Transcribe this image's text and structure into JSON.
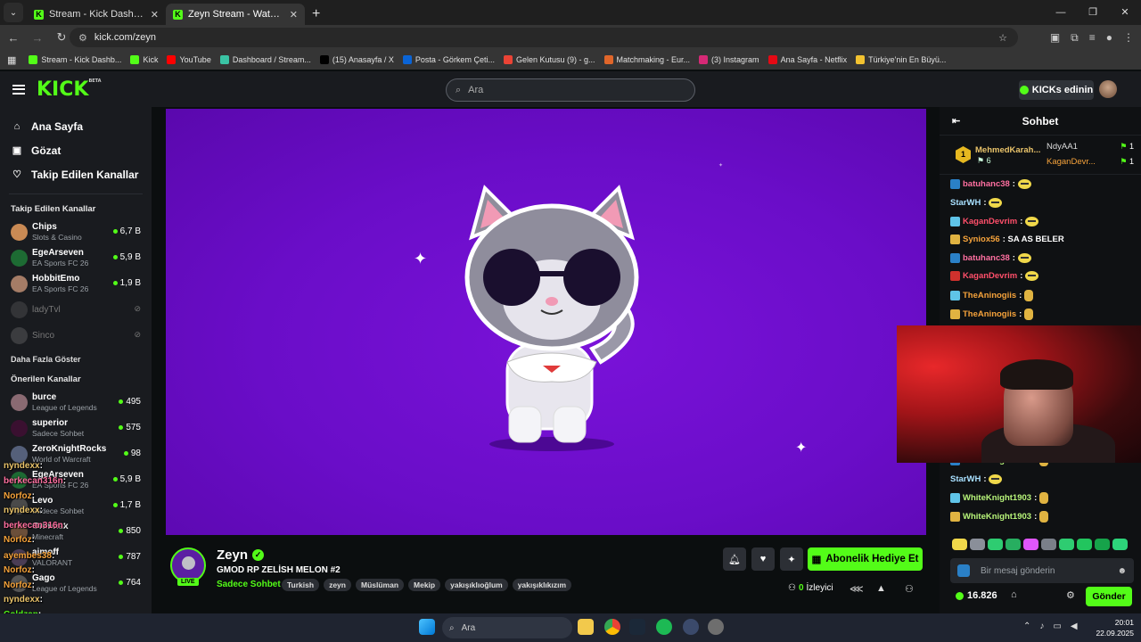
{
  "browser": {
    "tabs": [
      {
        "title": "Stream - Kick Dashboard",
        "active": false
      },
      {
        "title": "Zeyn Stream - Watch Live on Kick",
        "active": true
      }
    ],
    "url": "kick.com/zeyn",
    "bookmarks": [
      {
        "label": "Stream - Kick Dashb...",
        "color": "#53fc18"
      },
      {
        "label": "Kick",
        "color": "#53fc18"
      },
      {
        "label": "YouTube",
        "color": "#ff0000"
      },
      {
        "label": "Dashboard / Stream...",
        "color": "#3ac3a4"
      },
      {
        "label": "(15) Anasayfa / X",
        "color": "#000000"
      },
      {
        "label": "Posta - Görkem Çeti...",
        "color": "#0a64d6"
      },
      {
        "label": "Gelen Kutusu (9) - g...",
        "color": "#ea4335"
      },
      {
        "label": "Matchmaking - Eur...",
        "color": "#e0662a"
      },
      {
        "label": "(3) Instagram",
        "color": "#d62976"
      },
      {
        "label": "Ana Sayfa - Netflix",
        "color": "#e50914"
      },
      {
        "label": "Türkiye'nin En Büyü...",
        "color": "#f2c230"
      }
    ]
  },
  "header": {
    "logo": "KICK",
    "logo_beta": "BETA",
    "search_placeholder": "Ara",
    "kicks_button": "KICKs edinin"
  },
  "sidebar": {
    "nav": [
      {
        "label": "Ana Sayfa",
        "icon": "home-icon"
      },
      {
        "label": "Gözat",
        "icon": "browse-icon"
      },
      {
        "label": "Takip Edilen Kanallar",
        "icon": "heart-icon"
      }
    ],
    "followed_title": "Takip Edilen Kanallar",
    "followed": [
      {
        "name": "Chips",
        "game": "Slots & Casino",
        "viewers": "6,7 B",
        "avatar": "#c98a54"
      },
      {
        "name": "EgeArseven",
        "game": "EA Sports FC 26",
        "viewers": "5,9 B",
        "avatar": "#1d6b33"
      },
      {
        "name": "HobbitEmo",
        "game": "EA Sports FC 26",
        "viewers": "1,9 B",
        "avatar": "#a57c66"
      },
      {
        "name": "ladyTvl",
        "offline": true,
        "avatar": "#555555"
      },
      {
        "name": "Sinco",
        "offline": true,
        "avatar": "#666666"
      }
    ],
    "show_more": "Daha Fazla Göster",
    "recommended_title": "Önerilen Kanallar",
    "recommended": [
      {
        "name": "burce",
        "game": "League of Legends",
        "viewers": "495",
        "avatar": "#8a6a72"
      },
      {
        "name": "superior",
        "game": "Sadece Sohbet",
        "viewers": "575",
        "avatar": "#3a1030"
      },
      {
        "name": "ZeroKnightRocks",
        "game": "World of Warcraft",
        "viewers": "98",
        "avatar": "#55607a"
      },
      {
        "name": "EgeArseven",
        "game": "EA Sports FC 26",
        "viewers": "5,9 B",
        "avatar": "#1d6b33"
      },
      {
        "name": "Levo",
        "game": "Sadece Sohbet",
        "viewers": "1,7 B",
        "avatar": "#4a4a4a"
      },
      {
        "name": "Grimnax",
        "game": "Minecraft",
        "viewers": "850",
        "avatar": "#6b4f3a"
      },
      {
        "name": "aimoff",
        "game": "VALORANT",
        "viewers": "787",
        "avatar": "#4a3d55"
      },
      {
        "name": "Gago",
        "game": "League of Legends",
        "viewers": "764",
        "avatar": "#555555"
      }
    ],
    "overlay_chat": [
      {
        "user": "nyndexx",
        "text": ":",
        "color": "#e9c36a"
      },
      {
        "user": "berkecan316n",
        "text": ":",
        "color": "#ff6fa0"
      },
      {
        "user": "Norfoz",
        "text": ":",
        "color": "#f6a33b"
      },
      {
        "user": "nyndexx",
        "text": ":",
        "color": "#e9c36a"
      },
      {
        "user": "berkecan316n",
        "text": ":",
        "color": "#ff6fa0"
      },
      {
        "user": "Norfoz",
        "text": ":",
        "color": "#f6a33b"
      },
      {
        "user": "ayembes38",
        "text": ":",
        "color": "#f6a33b"
      },
      {
        "user": "Norfoz",
        "text": ":",
        "color": "#f6a33b"
      },
      {
        "user": "Norfoz",
        "text": ":",
        "color": "#f6a33b"
      },
      {
        "user": "nyndexx",
        "text": ":",
        "color": "#e9c36a"
      },
      {
        "user": "Coldzap",
        "text": ":",
        "color": "#53fc18"
      }
    ]
  },
  "stream": {
    "channel": "Zeyn",
    "live": "LIVE",
    "title": "GMOD RP ZELİSH MELON #2",
    "category": "Sadece Sohbet",
    "tags": [
      "Turkish",
      "zeyn",
      "Müslüman",
      "Mekip",
      "yakışıklıoğlum",
      "yakışıklıkızım"
    ],
    "subscribe_gift": "Abonelik Hediye Et",
    "viewers_count": "0",
    "viewers_label": "İzleyici"
  },
  "chat": {
    "title": "Sohbet",
    "pinned": {
      "top_user": "MehmedKarah...",
      "top_count": "6",
      "rank": "1",
      "others": [
        {
          "user": "NdyAA1",
          "count": "1"
        },
        {
          "user": "KaganDevr...",
          "count": "1"
        }
      ]
    },
    "messages": [
      {
        "user": "batuhanc38",
        "text": ":",
        "color": "#ff6fa0",
        "emote": "yellow"
      },
      {
        "user": "StarWH",
        "text": ":",
        "color": "#a8e0ff",
        "emote": "yellow"
      },
      {
        "user": "KaganDevrim",
        "text": ":",
        "color": "#ff4f6a",
        "emote": "yellow"
      },
      {
        "user": "Syniox56",
        "text": ": SA AS BELER",
        "color": "#f6a33b",
        "emote": ""
      },
      {
        "user": "batuhanc38",
        "text": ":",
        "color": "#ff6fa0",
        "emote": "yellow"
      },
      {
        "user": "KaganDevrim",
        "text": ":",
        "color": "#ff4f6a",
        "emote": "yellow"
      },
      {
        "user": "TheAninogiis",
        "text": ":",
        "color": "#f6a33b",
        "emote": "hand"
      },
      {
        "user": "TheAninogiis",
        "text": ":",
        "color": "#f6a33b",
        "emote": "hand"
      },
      {
        "user": "WhiteKnight1903",
        "text": ":",
        "color": "#b8f57a",
        "emote": "hand"
      },
      {
        "user": "StarWH",
        "text": ":",
        "color": "#a8e0ff",
        "emote": "yellow"
      },
      {
        "user": "WhiteKnight1903",
        "text": ":",
        "color": "#b8f57a",
        "emote": "hand"
      },
      {
        "user": "WhiteKnight1903",
        "text": ":",
        "color": "#b8f57a",
        "emote": "hand"
      }
    ],
    "input_placeholder": "Bir mesaj gönderin",
    "points": "16.826",
    "send": "Gönder"
  },
  "taskbar": {
    "search": "Ara",
    "time": "20:01",
    "date": "22.09.2025"
  }
}
